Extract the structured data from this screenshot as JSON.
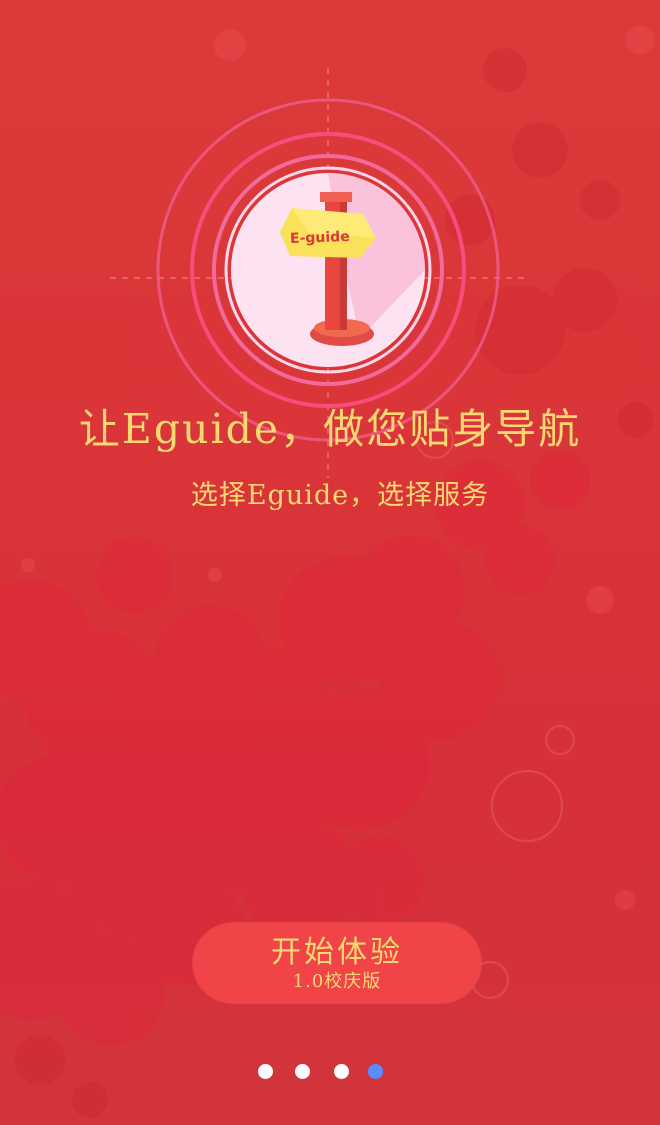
{
  "logo": {
    "badge_text": "E-guide"
  },
  "headline": "让Eguide，做您贴身导航",
  "subline": "选择Eguide，选择服务",
  "start_button": {
    "label": "开始体验",
    "version": "1.0校庆版"
  },
  "pager": {
    "total": 4,
    "active_index": 4,
    "dot_color": "#ffffff",
    "active_color": "#5b8cff"
  },
  "colors": {
    "background": "#d93438",
    "accent_text": "#f8d873",
    "button": "#f04448"
  }
}
